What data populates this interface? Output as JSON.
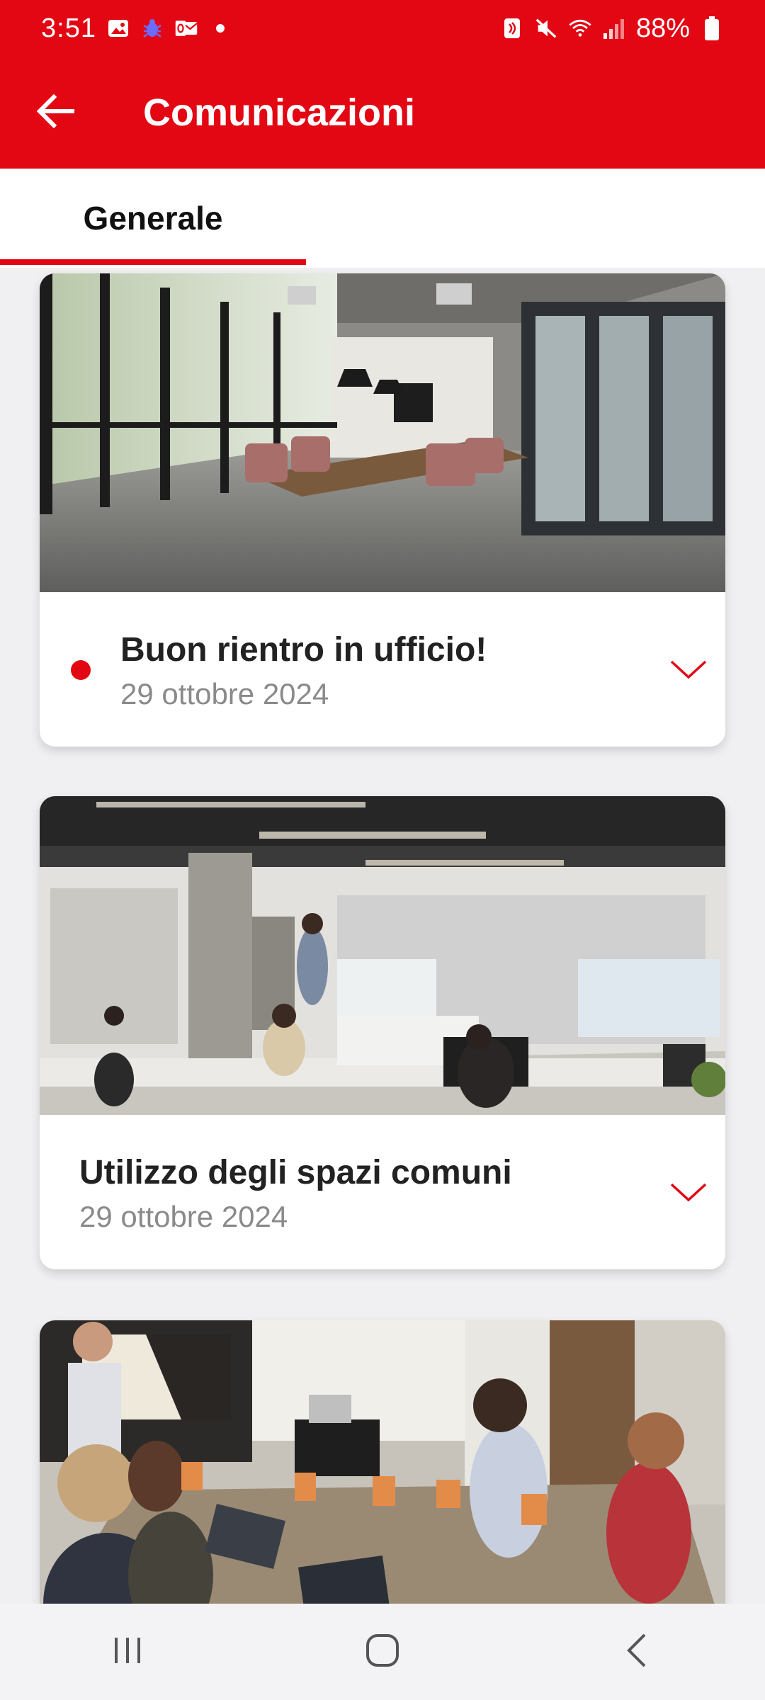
{
  "status_bar": {
    "time": "3:51",
    "battery": "88%",
    "left_icons": [
      "gallery-icon",
      "bug-icon",
      "outlook-icon",
      "dot-icon"
    ],
    "right_icons": [
      "nfc-icon",
      "mute-icon",
      "wifi-icon",
      "signal-icon",
      "battery-icon"
    ]
  },
  "app_bar": {
    "title": "Comunicazioni",
    "back_icon": "arrow-left-icon"
  },
  "tabs": [
    {
      "label": "Generale",
      "selected": true
    }
  ],
  "communications": [
    {
      "title": "Buon rientro in ufficio!",
      "date": "29 ottobre 2024",
      "unread": true,
      "image": "office-meeting-room-photo"
    },
    {
      "title": "Utilizzo degli spazi comuni",
      "date": "29 ottobre 2024",
      "unread": false,
      "image": "open-space-office-photo"
    },
    {
      "title": "",
      "date": "",
      "unread": false,
      "image": "team-meeting-photo"
    }
  ],
  "nav_bar": {
    "buttons": [
      "recents-icon",
      "home-icon",
      "back-icon"
    ]
  },
  "colors": {
    "brand_red": "#e30613",
    "background": "#f0f0f2",
    "date_gray": "#8a8a8a"
  }
}
